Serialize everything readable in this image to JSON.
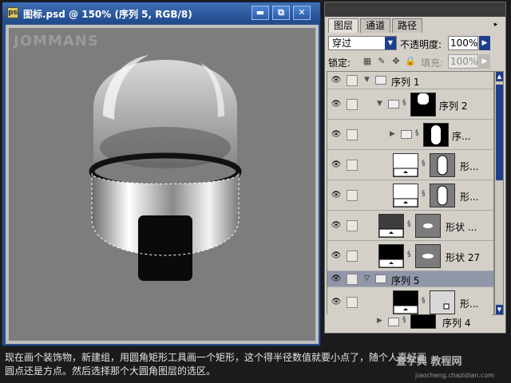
{
  "document": {
    "title": "图标.psd @ 150% (序列 5, RGB/8)",
    "app_icon_label": "ps",
    "minimize_label": "▬",
    "restore_label": "⧉",
    "close_label": "✕",
    "watermark": "JOMMANS"
  },
  "layers_panel": {
    "tabs": [
      "图层",
      "通道",
      "路径"
    ],
    "menu_label": "▸",
    "blend_mode": "穿过",
    "opacity_label": "不透明度:",
    "opacity_value": "100%",
    "lock_label": "锁定:",
    "fill_label": "填充:",
    "fill_value": "100%",
    "layers": [
      {
        "name": "序列 1",
        "type": "group",
        "indent": 0,
        "expanded": true
      },
      {
        "name": "序列 2",
        "type": "group-thumb",
        "indent": 1,
        "expanded": true
      },
      {
        "name": "序...",
        "type": "group-thumb",
        "indent": 2,
        "expanded": false
      },
      {
        "name": "形...",
        "type": "shape",
        "indent": 2
      },
      {
        "name": "形...",
        "type": "shape",
        "indent": 2
      },
      {
        "name": "形状 ...",
        "type": "shape-dark",
        "indent": 1
      },
      {
        "name": "形状 27",
        "type": "shape-black",
        "indent": 1
      },
      {
        "name": "序列 5",
        "type": "group",
        "indent": 0,
        "expanded": true,
        "selected": true
      },
      {
        "name": "形...",
        "type": "shape-black-small",
        "indent": 1
      },
      {
        "name": "序列 4",
        "type": "group-thumb",
        "indent": 1,
        "expanded": false
      }
    ]
  },
  "caption": {
    "line1": "现在画个装饰物，新建组，用圆角矩形工具画一个矩形，这个得半径数值就要小点了，随个人喜好画",
    "line2": "圆点还是方点。然后选择那个大圆角图层的选区。"
  },
  "site": {
    "logo": "查字典 教程网",
    "url": "jiaocheng.chazidian.com"
  },
  "colors": {
    "title_bar": "#2a4f87",
    "canvas_bg": "#7d7d7d",
    "panel_bg": "#d4d0c8",
    "selected_row": "#8f97a8"
  }
}
